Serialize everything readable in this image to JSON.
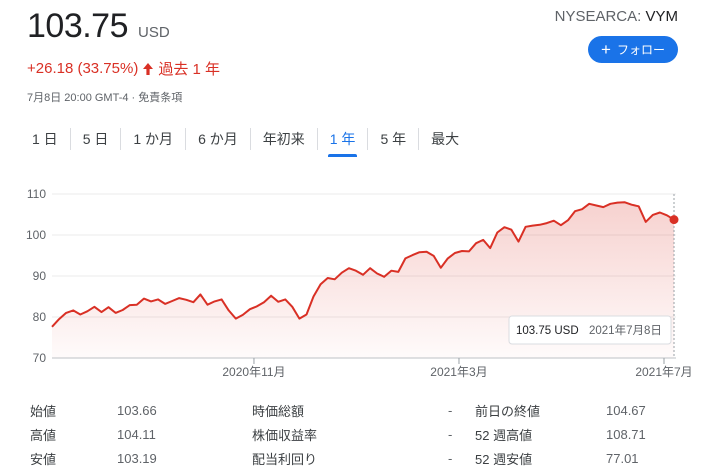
{
  "header": {
    "price": "103.75",
    "currency": "USD",
    "exchange": "NYSEARCA: ",
    "symbol": "VYM",
    "follow_label": "フォロー",
    "change": "+26.18 (33.75%)",
    "period": "過去 1 年",
    "meta": "7月8日 20:00 GMT-4 · 免責条項",
    "change_color": "#d93025"
  },
  "tabs": [
    "1 日",
    "5 日",
    "1 か月",
    "6 か月",
    "年初来",
    "1 年",
    "5 年",
    "最大"
  ],
  "active_tab": 5,
  "chart_data": {
    "type": "area",
    "title": "",
    "xlabel": "",
    "ylabel": "",
    "ylim": [
      70,
      110
    ],
    "yticks": [
      70,
      80,
      90,
      100,
      110
    ],
    "grid": true,
    "x_tick_labels": [
      "2020年11月",
      "2021年3月",
      "2021年7月"
    ],
    "x_tick_positions": [
      0.33,
      0.665,
      1.0
    ],
    "line_color": "#d93025",
    "tooltip": {
      "value": "103.75 USD",
      "date": "2021年7月8日"
    },
    "series": [
      {
        "values": [
          77.6,
          79.5,
          81.0,
          81.6,
          80.6,
          81.4,
          82.5,
          81.2,
          82.4,
          81.0,
          81.7,
          82.9,
          83.0,
          84.5,
          83.8,
          84.3,
          83.2,
          83.9,
          84.6,
          84.2,
          83.6,
          85.5,
          83.0,
          83.8,
          84.3,
          81.6,
          79.6,
          80.5,
          81.9,
          82.6,
          83.6,
          85.2,
          83.7,
          84.3,
          82.5,
          79.6,
          80.6,
          85.0,
          88.0,
          89.5,
          89.2,
          90.8,
          91.9,
          91.3,
          90.3,
          91.9,
          90.6,
          89.8,
          91.3,
          91.0,
          94.3,
          95.1,
          95.8,
          95.9,
          94.9,
          92.0,
          94.3,
          95.6,
          96.1,
          96.0,
          98.0,
          98.8,
          96.8,
          100.6,
          101.9,
          101.3,
          98.4,
          102.0,
          102.3,
          102.5,
          102.9,
          103.5,
          102.4,
          103.6,
          105.8,
          106.3,
          107.6,
          107.2,
          106.8,
          107.6,
          107.9,
          108.0,
          107.4,
          107.0,
          103.2,
          104.9,
          105.5,
          104.8,
          103.75
        ]
      }
    ]
  },
  "stats": [
    [
      "始値",
      "103.66",
      "時価総額",
      "-",
      "前日の終値",
      "104.67"
    ],
    [
      "高値",
      "104.11",
      "株価収益率",
      "-",
      "52 週高値",
      "108.71"
    ],
    [
      "安値",
      "103.19",
      "配当利回り",
      "-",
      "52 週安値",
      "77.01"
    ]
  ]
}
